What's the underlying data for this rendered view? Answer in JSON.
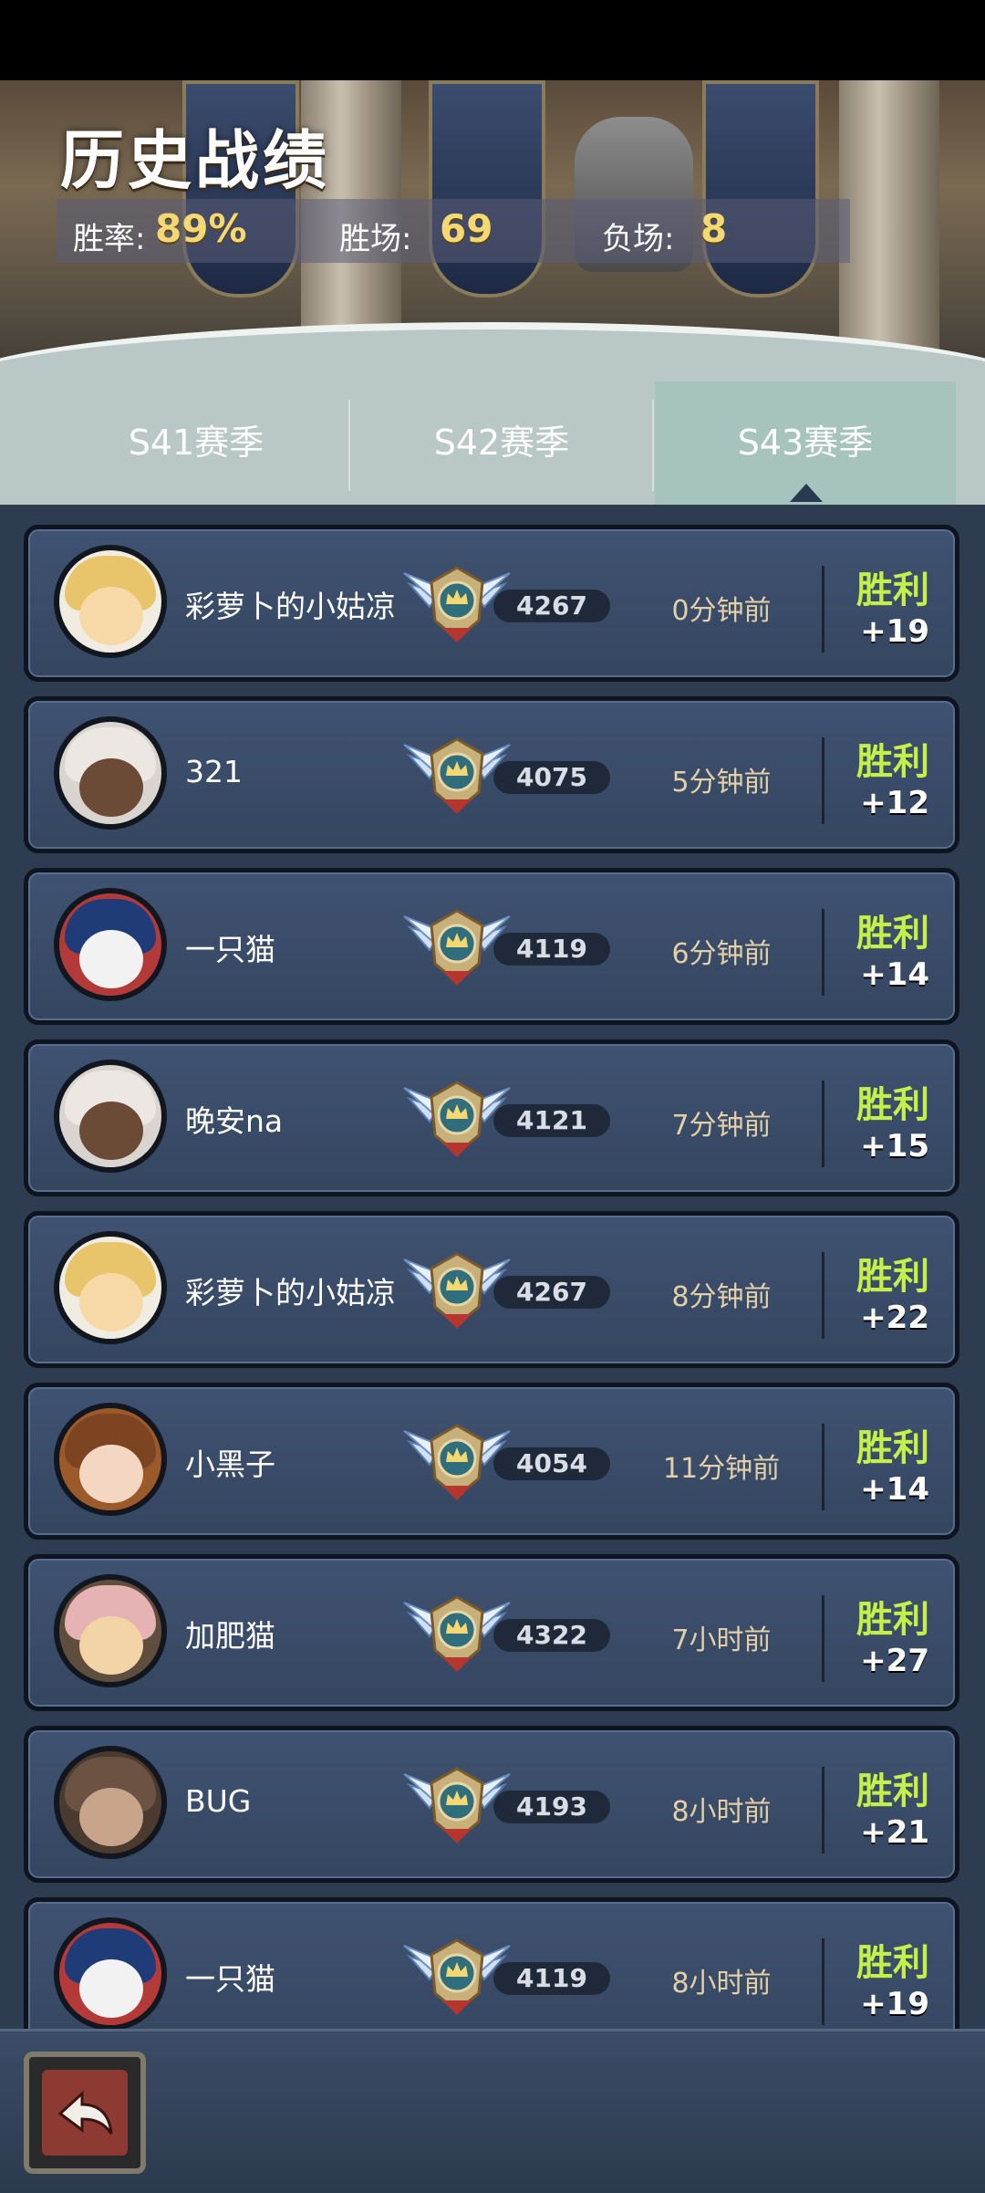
{
  "header": {
    "title": "历史战绩",
    "win_rate_label": "胜率:",
    "win_rate_value": "89%",
    "wins_label": "胜场:",
    "wins_value": "69",
    "losses_label": "负场:",
    "losses_value": "8"
  },
  "tabs": [
    {
      "label": "S41赛季",
      "active": false
    },
    {
      "label": "S42赛季",
      "active": false
    },
    {
      "label": "S43赛季",
      "active": true
    }
  ],
  "matches": [
    {
      "name": "彩萝卜的小姑凉",
      "score": "4267",
      "time": "0分钟前",
      "result": "胜利",
      "delta": "+19",
      "avatar": "panda-hood-blonde"
    },
    {
      "name": "321",
      "score": "4075",
      "time": "5分钟前",
      "result": "胜利",
      "delta": "+12",
      "avatar": "white-hair-dark-skin"
    },
    {
      "name": "一只猫",
      "score": "4119",
      "time": "6分钟前",
      "result": "胜利",
      "delta": "+14",
      "avatar": "red-hat-cat"
    },
    {
      "name": "晚安na",
      "score": "4121",
      "time": "7分钟前",
      "result": "胜利",
      "delta": "+15",
      "avatar": "white-hair-dark-skin"
    },
    {
      "name": "彩萝卜的小姑凉",
      "score": "4267",
      "time": "8分钟前",
      "result": "胜利",
      "delta": "+22",
      "avatar": "panda-hood-blonde"
    },
    {
      "name": "小黑子",
      "score": "4054",
      "time": "11分钟前",
      "result": "胜利",
      "delta": "+14",
      "avatar": "pumpkin-hood"
    },
    {
      "name": "加肥猫",
      "score": "4322",
      "time": "7小时前",
      "result": "胜利",
      "delta": "+27",
      "avatar": "raccoon-hood"
    },
    {
      "name": "BUG",
      "score": "4193",
      "time": "8小时前",
      "result": "胜利",
      "delta": "+21",
      "avatar": "monkey"
    },
    {
      "name": "一只猫",
      "score": "4119",
      "time": "8小时前",
      "result": "胜利",
      "delta": "+19",
      "avatar": "red-hat-cat"
    }
  ],
  "colors": {
    "win_text": "#c5f04a",
    "stat_value": "#f4d873",
    "row_bg": "#3f5272",
    "time_text": "#e3cfa8"
  },
  "icons": {
    "rank_badge": "winged-crown-badge-icon",
    "back": "back-arrow-icon"
  }
}
